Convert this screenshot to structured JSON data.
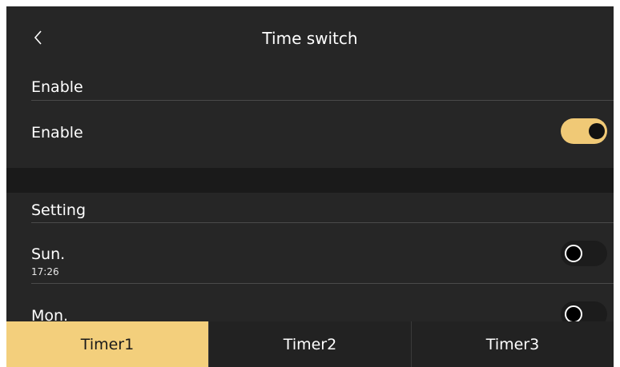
{
  "header": {
    "title": "Time switch"
  },
  "sections": {
    "enable_header": "Enable",
    "setting_header": "Setting"
  },
  "enable_row": {
    "label": "Enable",
    "toggle_on": true
  },
  "days": [
    {
      "label": "Sun.",
      "time": "17:26",
      "toggle_on": false
    },
    {
      "label": "Mon.",
      "time": "",
      "toggle_on": false
    }
  ],
  "tabs": [
    {
      "label": "Timer1",
      "active": true
    },
    {
      "label": "Timer2",
      "active": false
    },
    {
      "label": "Timer3",
      "active": false
    }
  ],
  "colors": {
    "accent": "#f0c976",
    "background": "#262626",
    "tab_bar": "#222222"
  }
}
